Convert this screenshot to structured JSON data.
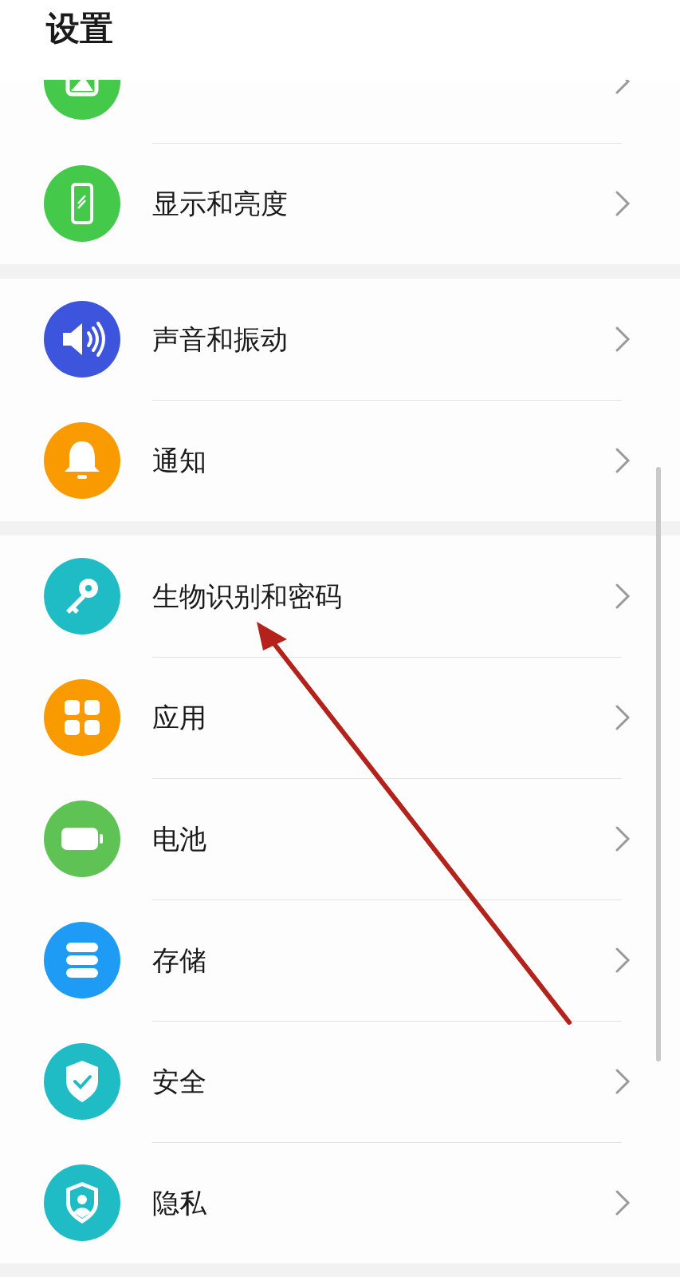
{
  "header": {
    "title": "设置"
  },
  "groups": [
    {
      "items": [
        {
          "color": "#45c94a"
        },
        {
          "label": "显示和亮度",
          "color": "#45c94a"
        }
      ]
    },
    {
      "items": [
        {
          "label": "声音和振动",
          "color": "#3d55dc"
        },
        {
          "label": "通知",
          "color": "#f99b00"
        }
      ]
    },
    {
      "items": [
        {
          "label": "生物识别和密码",
          "color": "#1fbcc6"
        },
        {
          "label": "应用",
          "color": "#f99b00"
        },
        {
          "label": "电池",
          "color": "#5ec354"
        },
        {
          "label": "存储",
          "color": "#1d9bf5"
        },
        {
          "label": "安全",
          "color": "#1fbcc6"
        },
        {
          "label": "隐私",
          "color": "#1fbcc6"
        }
      ]
    }
  ]
}
